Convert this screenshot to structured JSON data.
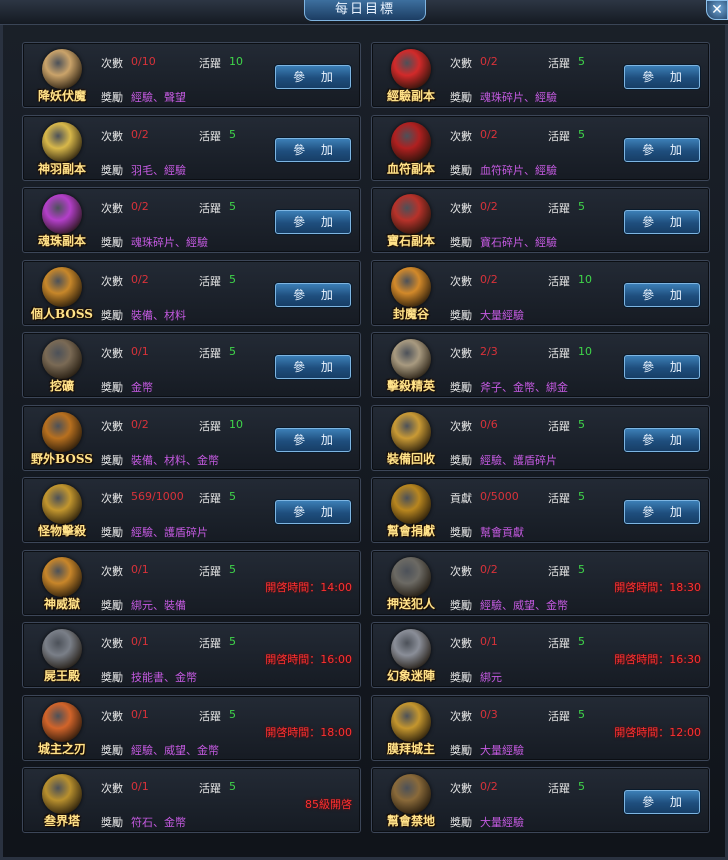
{
  "window": {
    "title": "每日目標",
    "close_glyph": "✕"
  },
  "labels": {
    "times": "次數",
    "activity": "活躍",
    "reward": "獎勵",
    "contribution": "貢獻",
    "join": "參 加"
  },
  "tasks": [
    {
      "name": "降妖伏魔",
      "count": "0/10",
      "activity": "10",
      "reward": "經驗、聲望",
      "action": "join",
      "icon": "scroll-icon",
      "color": "#caa36a"
    },
    {
      "name": "經驗副本",
      "count": "0/2",
      "activity": "5",
      "reward": "魂珠碎片、經驗",
      "action": "join",
      "icon": "red-orb-icon",
      "color": "#d22a2a"
    },
    {
      "name": "神羽副本",
      "count": "0/2",
      "activity": "5",
      "reward": "羽毛、經驗",
      "action": "join",
      "icon": "feather-icon",
      "color": "#d8b84a"
    },
    {
      "name": "血符副本",
      "count": "0/2",
      "activity": "5",
      "reward": "血符碎片、經驗",
      "action": "join",
      "icon": "blood-gem-icon",
      "color": "#b02020"
    },
    {
      "name": "魂珠副本",
      "count": "0/2",
      "activity": "5",
      "reward": "魂珠碎片、經驗",
      "action": "join",
      "icon": "soul-orb-icon",
      "color": "#b33fc9"
    },
    {
      "name": "寶石副本",
      "count": "0/2",
      "activity": "5",
      "reward": "寶石碎片、經驗",
      "action": "join",
      "icon": "gem-icon",
      "color": "#b7322a"
    },
    {
      "name": "個人BOSS",
      "count": "0/2",
      "activity": "5",
      "reward": "裝備、材料",
      "action": "join",
      "icon": "demon-head-icon",
      "color": "#c7872a"
    },
    {
      "name": "封魔谷",
      "count": "0/2",
      "activity": "10",
      "reward": "大量經驗",
      "action": "join",
      "icon": "brazier-icon",
      "color": "#d2892a"
    },
    {
      "name": "挖礦",
      "count": "0/1",
      "activity": "5",
      "reward": "金幣",
      "action": "join",
      "icon": "pickaxe-icon",
      "color": "#7a6a55"
    },
    {
      "name": "擊殺精英",
      "count": "2/3",
      "activity": "10",
      "reward": "斧子、金幣、綁金",
      "action": "join",
      "icon": "swords-icon",
      "color": "#a89a80"
    },
    {
      "name": "野外BOSS",
      "count": "0/2",
      "activity": "10",
      "reward": "裝備、材料、金幣",
      "action": "join",
      "icon": "boss-mask-icon",
      "color": "#b8701f"
    },
    {
      "name": "裝備回收",
      "count": "0/6",
      "activity": "5",
      "reward": "經驗、護盾碎片",
      "action": "join",
      "icon": "cauldron-icon",
      "color": "#c99a35"
    },
    {
      "name": "怪物擊殺",
      "count": "569/1000",
      "activity": "5",
      "reward": "經驗、護盾碎片",
      "action": "join",
      "icon": "shield-icon",
      "color": "#c2962e"
    },
    {
      "name": "幫會捐獻",
      "count": "0/5000",
      "activity": "5",
      "reward": "幫會貢獻",
      "action": "join",
      "count_label": "contribution",
      "icon": "donation-icon",
      "color": "#b8861f"
    },
    {
      "name": "神威獄",
      "count": "0/1",
      "activity": "5",
      "reward": "綁元、裝備",
      "action": "time",
      "time": "開啓時間：14:00",
      "icon": "temple-icon",
      "color": "#c8862a"
    },
    {
      "name": "押送犯人",
      "count": "0/2",
      "activity": "5",
      "reward": "經驗、威望、金幣",
      "action": "time",
      "time": "開啓時間：18:30",
      "icon": "prisoner-icon",
      "color": "#6c6a64"
    },
    {
      "name": "屍王殿",
      "count": "0/1",
      "activity": "5",
      "reward": "技能書、金幣",
      "action": "time",
      "time": "開啓時間：16:00",
      "icon": "corpse-king-icon",
      "color": "#7a7f88"
    },
    {
      "name": "幻象迷陣",
      "count": "0/1",
      "activity": "5",
      "reward": "綁元",
      "action": "time",
      "time": "開啓時間：16:30",
      "icon": "illusion-icon",
      "color": "#8a8e98"
    },
    {
      "name": "城主之刃",
      "count": "0/1",
      "activity": "5",
      "reward": "經驗、威望、金幣",
      "action": "time",
      "time": "開啓時間：18:00",
      "icon": "flame-blade-icon",
      "color": "#d2642a"
    },
    {
      "name": "膜拜城主",
      "count": "0/3",
      "activity": "5",
      "reward": "大量經驗",
      "action": "time",
      "time": "開啓時間：12:00",
      "icon": "armored-lord-icon",
      "color": "#c4962e"
    },
    {
      "name": "叁界塔",
      "count": "0/1",
      "activity": "5",
      "reward": "符石、金幣",
      "action": "time",
      "time": "85級開啓",
      "icon": "tower-icon",
      "color": "#b8902e"
    },
    {
      "name": "幫會禁地",
      "count": "0/2",
      "activity": "5",
      "reward": "大量經驗",
      "action": "join",
      "icon": "skull-gate-icon",
      "color": "#8a6a3a"
    }
  ]
}
